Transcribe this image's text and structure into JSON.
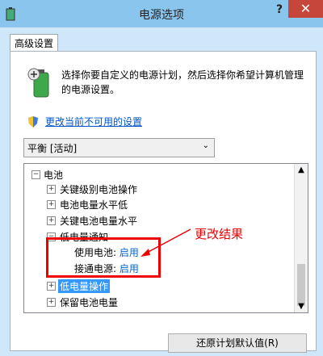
{
  "window": {
    "title": "电源选项",
    "help_label": "?",
    "close_label": "✕",
    "tab_label": "高级设置"
  },
  "description": "选择你要自定义的电源计划，然后选择你希望计算机管理的电源设置。",
  "link_text": "更改当前不可用的设置",
  "plan_select": {
    "value": "平衡 [活动]"
  },
  "tree": {
    "root": "电池",
    "items": [
      "关键级别电池操作",
      "电池电量水平低",
      "关键电池电量水平",
      "低电量通知"
    ],
    "on_battery_label": "使用电池:",
    "on_battery_value": "启用",
    "plugged_in_label": "接通电源:",
    "plugged_in_value": "启用",
    "after_items": [
      "低电量操作",
      "保留电池电量"
    ]
  },
  "annotation": "更改结果",
  "restore_button": "还原计划默认值(R)"
}
